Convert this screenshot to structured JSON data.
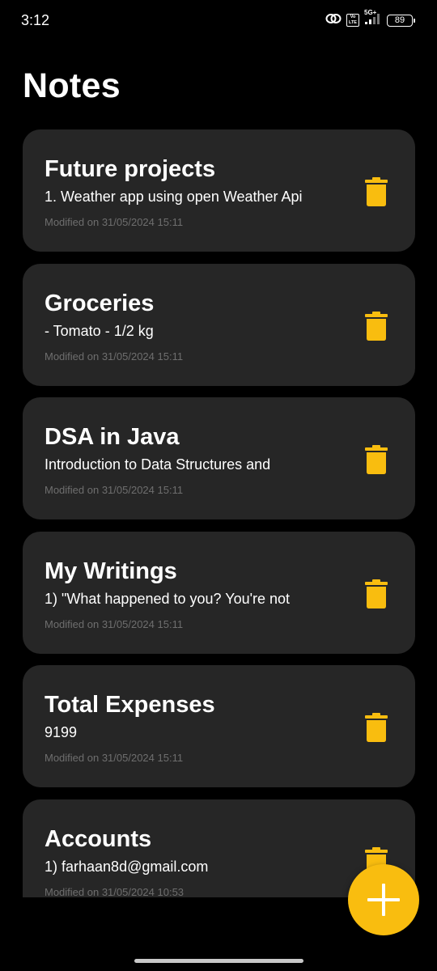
{
  "status_bar": {
    "time": "3:12",
    "volte_label": "Vo LTE",
    "network_type": "5G+",
    "battery": "89"
  },
  "header": {
    "title": "Notes"
  },
  "notes": [
    {
      "title": "Future projects",
      "preview": "1. Weather app using open Weather Api",
      "modified": "Modified on 31/05/2024 15:11"
    },
    {
      "title": "Groceries",
      "preview": "- Tomato - 1/2 kg",
      "modified": "Modified on 31/05/2024 15:11"
    },
    {
      "title": "DSA in Java",
      "preview": "Introduction to Data Structures and",
      "modified": "Modified on 31/05/2024 15:11"
    },
    {
      "title": "My Writings",
      "preview": "1) \"What happened to you? You're not",
      "modified": "Modified on 31/05/2024 15:11"
    },
    {
      "title": "Total Expenses",
      "preview": "9199",
      "modified": "Modified on 31/05/2024 15:11"
    },
    {
      "title": "Accounts",
      "preview": "1) farhaan8d@gmail.com",
      "modified": "Modified on 31/05/2024 10:53"
    }
  ],
  "icons": {
    "delete": "trash-icon",
    "fab": "plus-icon"
  },
  "colors": {
    "background": "#000000",
    "card": "#262626",
    "accent": "#f9bd0f",
    "text_primary": "#ffffff",
    "text_secondary": "#6e6e6e"
  }
}
